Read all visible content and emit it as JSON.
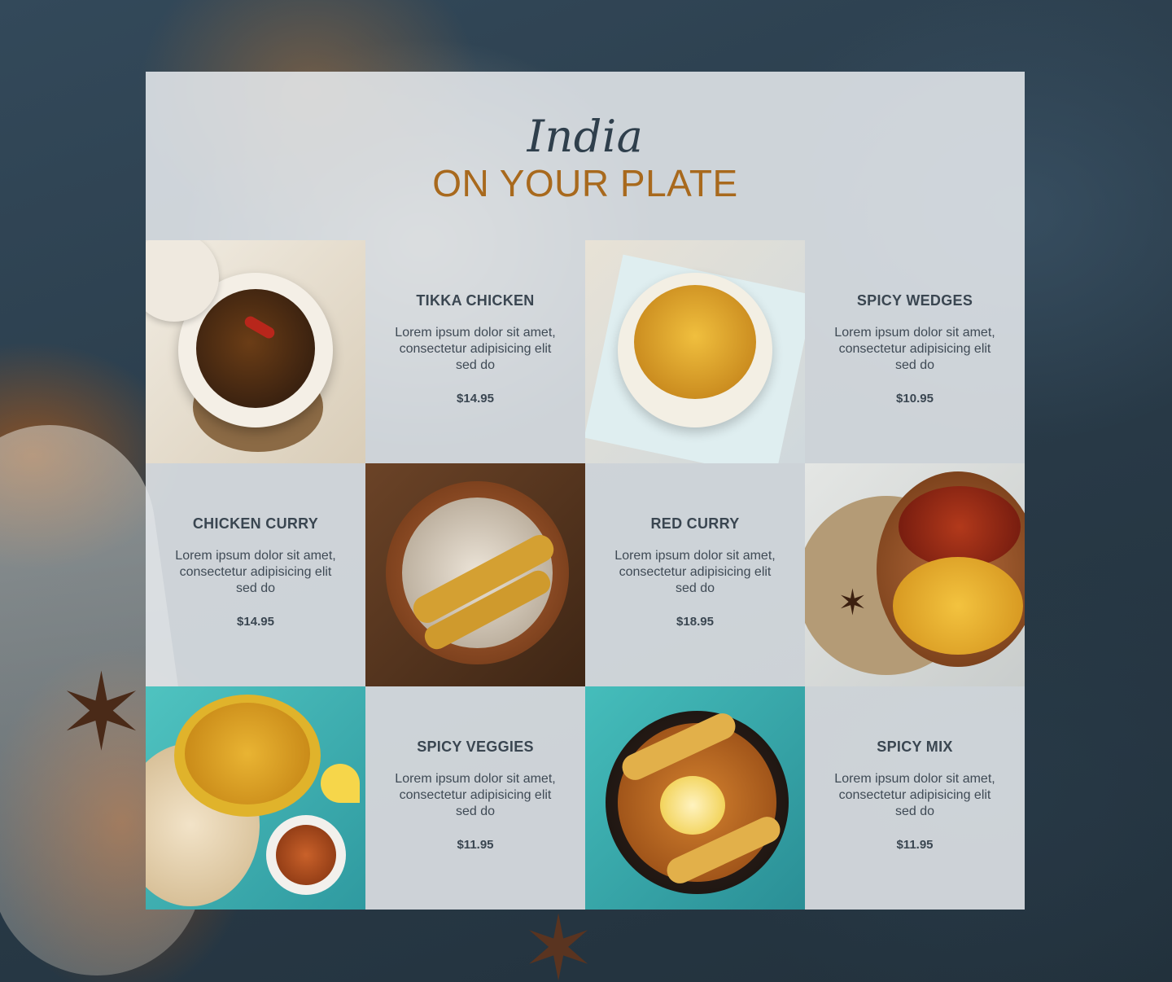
{
  "header": {
    "script_title": "India",
    "main_title": "ON YOUR PLATE"
  },
  "menu": {
    "items": [
      {
        "name": "TIKKA CHICKEN",
        "description": "Lorem ipsum dolor sit amet, consectetur adipisicing elit sed do",
        "price": "$14.95",
        "photo_icon": "noodles-bowl-photo"
      },
      {
        "name": "SPICY WEDGES",
        "description": "Lorem ipsum dolor sit amet, consectetur adipisicing elit sed do",
        "price": "$10.95",
        "photo_icon": "potato-wedges-photo"
      },
      {
        "name": "CHICKEN CURRY",
        "description": "Lorem ipsum dolor sit amet, consectetur adipisicing elit sed do",
        "price": "$14.95",
        "photo_icon": "chicken-skewers-rice-photo"
      },
      {
        "name": "RED CURRY",
        "description": "Lorem ipsum dolor sit amet, consectetur adipisicing elit sed do",
        "price": "$18.95",
        "photo_icon": "red-curry-rice-photo"
      },
      {
        "name": "SPICY VEGGIES",
        "description": "Lorem ipsum dolor sit amet, consectetur adipisicing elit sed do",
        "price": "$11.95",
        "photo_icon": "yellow-rice-naan-photo"
      },
      {
        "name": "SPICY MIX",
        "description": "Lorem ipsum dolor sit amet, consectetur adipisicing elit sed do",
        "price": "$11.95",
        "photo_icon": "chickpeas-skewers-photo"
      }
    ]
  },
  "colors": {
    "panel_background": "#e9ecf0",
    "title_dark": "#2f3f4c",
    "title_accent": "#a8691d",
    "body_text": "#3a4651"
  }
}
